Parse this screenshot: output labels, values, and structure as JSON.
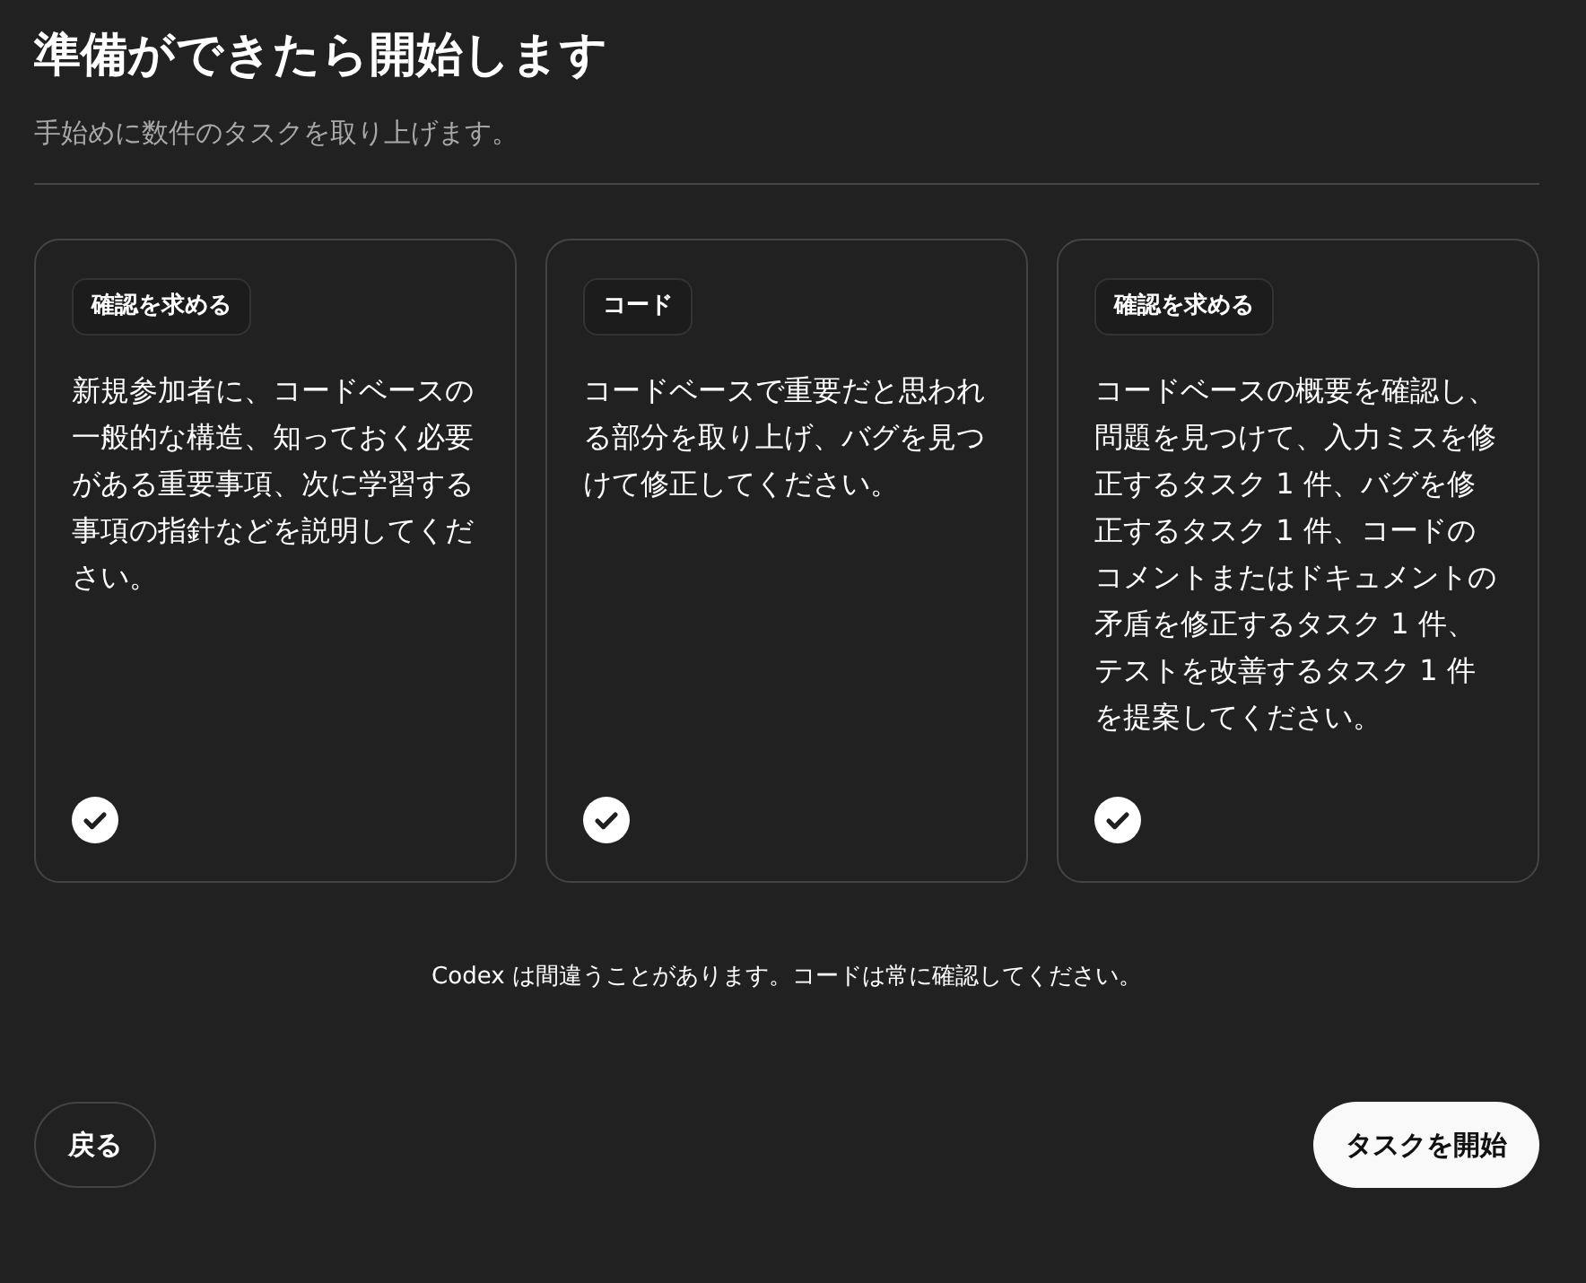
{
  "header": {
    "title": "準備ができたら開始します",
    "subtitle": "手始めに数件のタスクを取り上げます。"
  },
  "cards": [
    {
      "tag": "確認を求める",
      "text": "新規参加者に、コードベースの一般的な構造、知っておく必要がある重要事項、次に学習する事項の指針などを説明してください。",
      "checked": true
    },
    {
      "tag": "コード",
      "text": "コードベースで重要だと思われる部分を取り上げ、バグを見つけて修正してください。",
      "checked": true
    },
    {
      "tag": "確認を求める",
      "text": "コードベースの概要を確認し、問題を見つけて、入力ミスを修正するタスク 1 件、バグを修正するタスク 1 件、コードのコメントまたはドキュメントの矛盾を修正するタスク 1 件、テストを改善するタスク 1 件を提案してください。",
      "checked": true
    }
  ],
  "disclaimer": "Codex は間違うことがあります。コードは常に確認してください。",
  "buttons": {
    "back": "戻る",
    "start": "タスクを開始"
  }
}
